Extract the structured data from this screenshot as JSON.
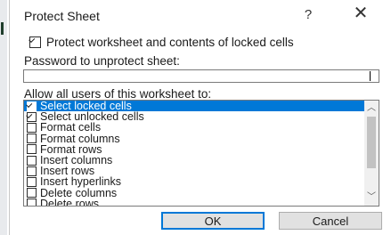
{
  "dialog": {
    "title": "Protect Sheet",
    "help_glyph": "?",
    "close_glyph": "✕"
  },
  "protect": {
    "label": "Protect worksheet and contents of locked cells",
    "checked": true
  },
  "password": {
    "label": "Password to unprotect sheet:",
    "value": ""
  },
  "permissions": {
    "label": "Allow all users of this worksheet to:",
    "items": [
      {
        "label": "Select locked cells",
        "checked": true,
        "selected": true
      },
      {
        "label": "Select unlocked cells",
        "checked": true,
        "selected": false
      },
      {
        "label": "Format cells",
        "checked": false,
        "selected": false
      },
      {
        "label": "Format columns",
        "checked": false,
        "selected": false
      },
      {
        "label": "Format rows",
        "checked": false,
        "selected": false
      },
      {
        "label": "Insert columns",
        "checked": false,
        "selected": false
      },
      {
        "label": "Insert rows",
        "checked": false,
        "selected": false
      },
      {
        "label": "Insert hyperlinks",
        "checked": false,
        "selected": false
      },
      {
        "label": "Delete columns",
        "checked": false,
        "selected": false
      },
      {
        "label": "Delete rows",
        "checked": false,
        "selected": false
      }
    ]
  },
  "buttons": {
    "ok": "OK",
    "cancel": "Cancel"
  },
  "colors": {
    "selection": "#0078d7",
    "ok_border": "#0078d7"
  },
  "icons": {
    "help": "question-mark-icon",
    "close": "close-icon",
    "scroll_up": "chevron-up-icon",
    "scroll_down": "chevron-down-icon"
  }
}
